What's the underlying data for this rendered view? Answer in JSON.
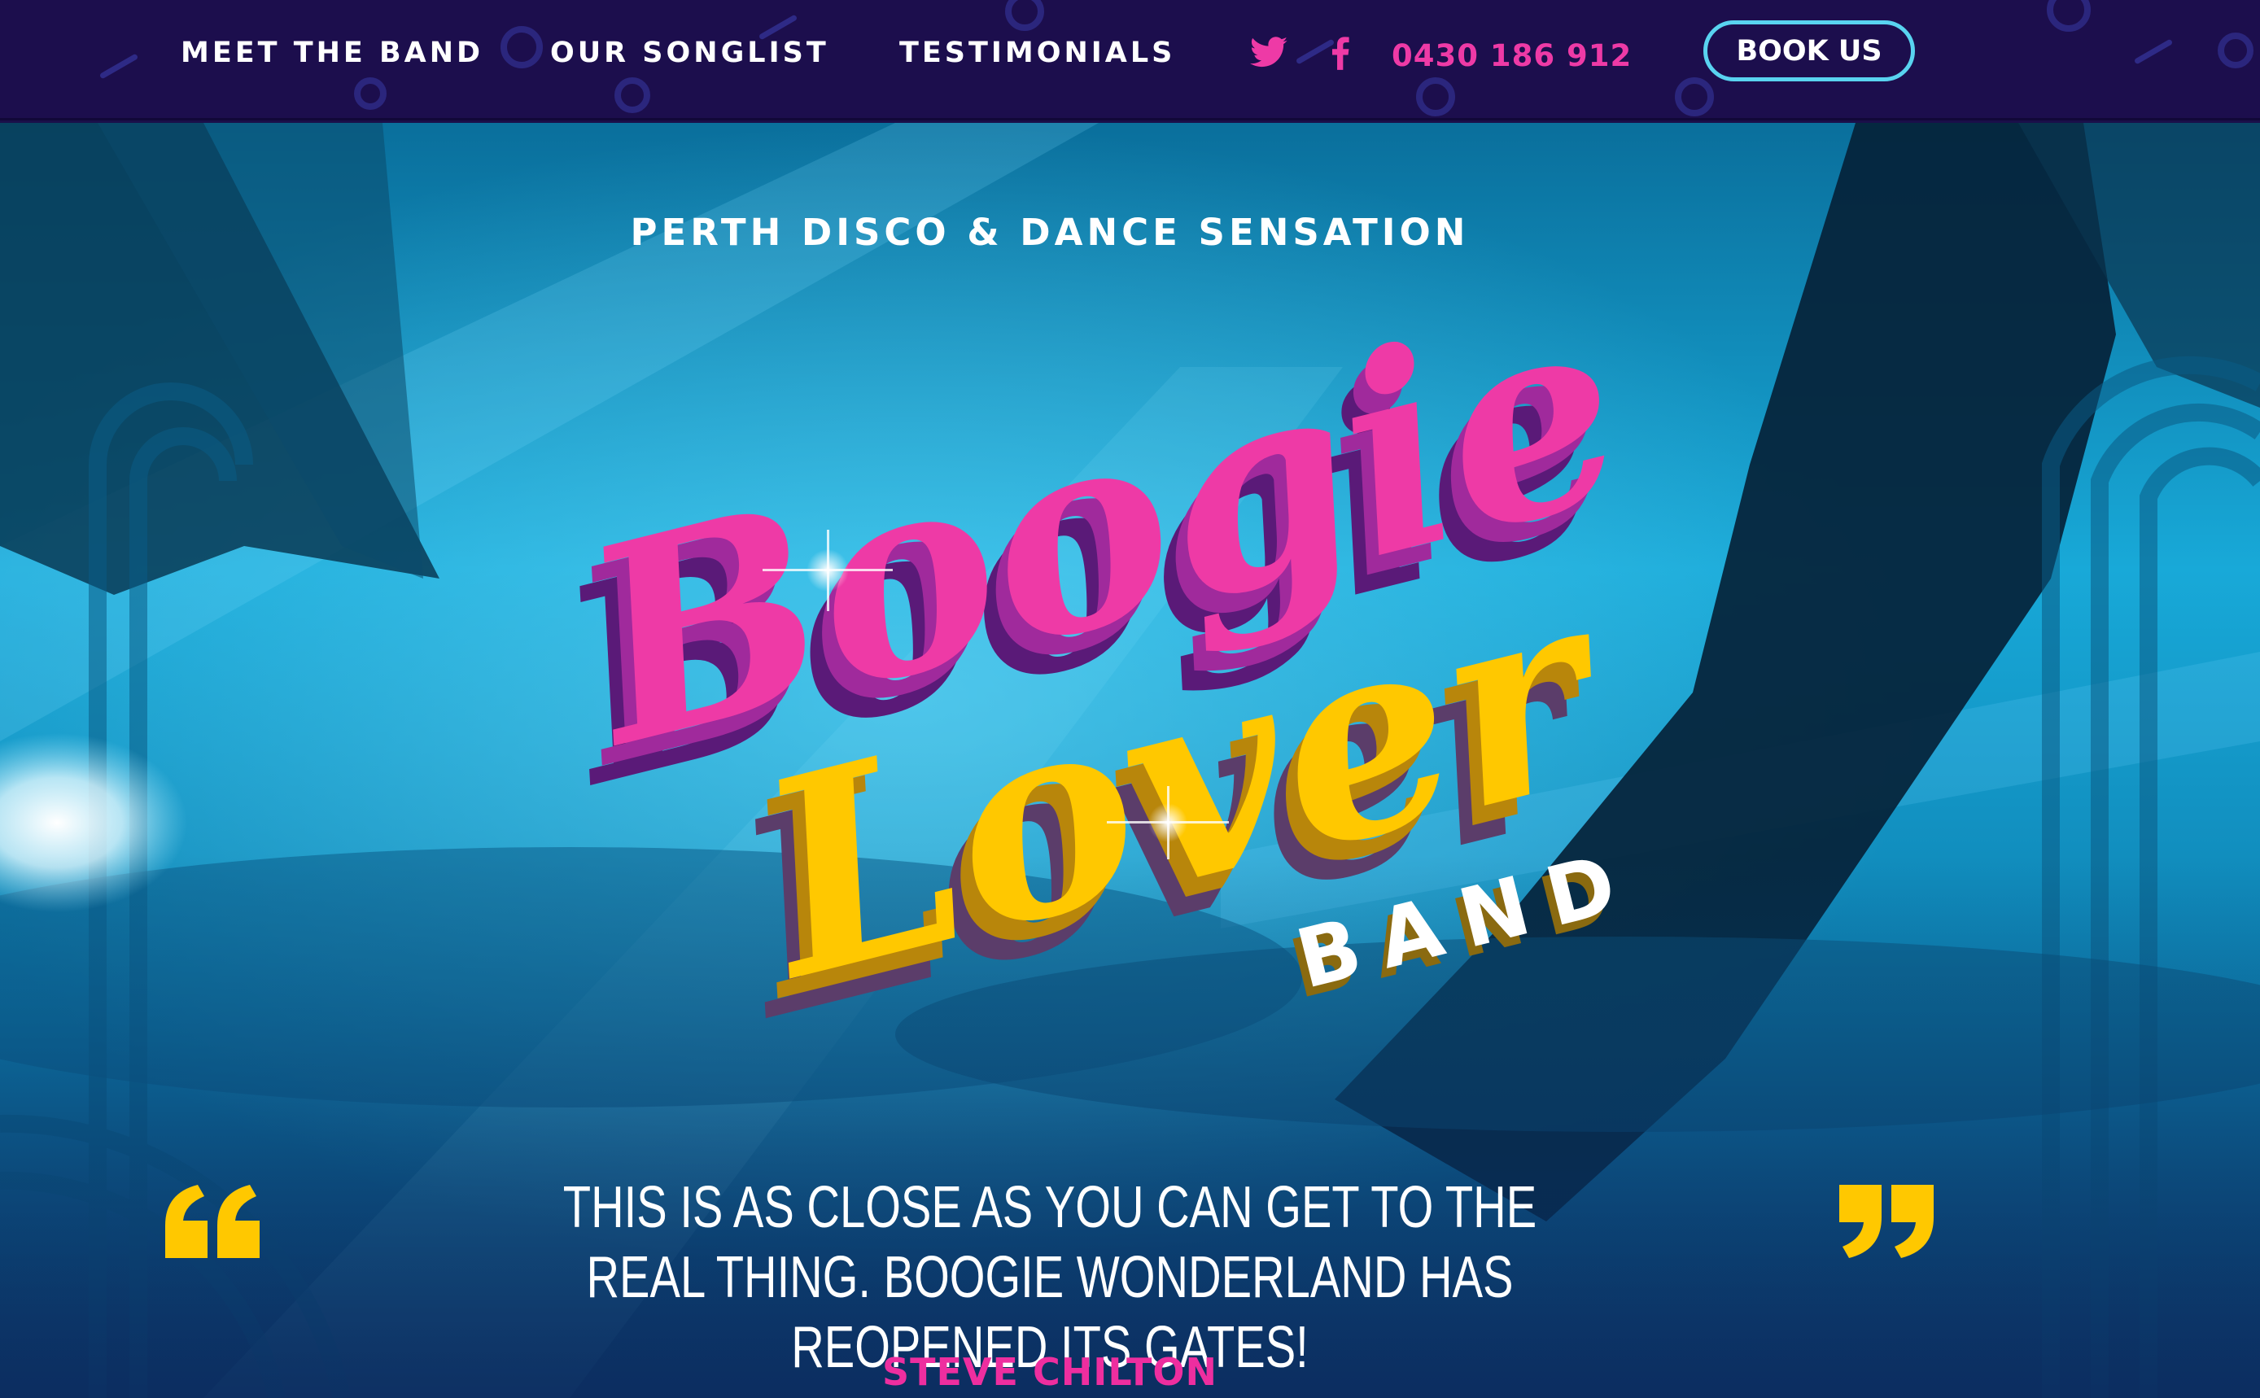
{
  "nav": {
    "links": [
      {
        "label": "MEET THE BAND"
      },
      {
        "label": "OUR SONGLIST"
      },
      {
        "label": "TESTIMONIALS"
      }
    ],
    "social": [
      {
        "icon": "twitter-icon"
      },
      {
        "icon": "facebook-icon"
      }
    ],
    "phone": "0430 186 912",
    "book_label": "BOOK US"
  },
  "hero": {
    "tagline": "PERTH DISCO & DANCE SENSATION",
    "logo": {
      "line1": "Boogie",
      "line2": "Lover",
      "line3": "BAND"
    },
    "quote": "THIS IS AS CLOSE AS YOU CAN GET TO THE REAL THING.  BOOGIE WONDERLAND HAS REOPENED ITS GATES!",
    "author": "STEVE CHILTON"
  },
  "colors": {
    "nav_bg": "#1c0e4d",
    "accent_pink": "#ee2e9f",
    "accent_yellow": "#ffc800",
    "accent_cyan": "#59d3f0",
    "hero_blue": "#0f97c8"
  }
}
